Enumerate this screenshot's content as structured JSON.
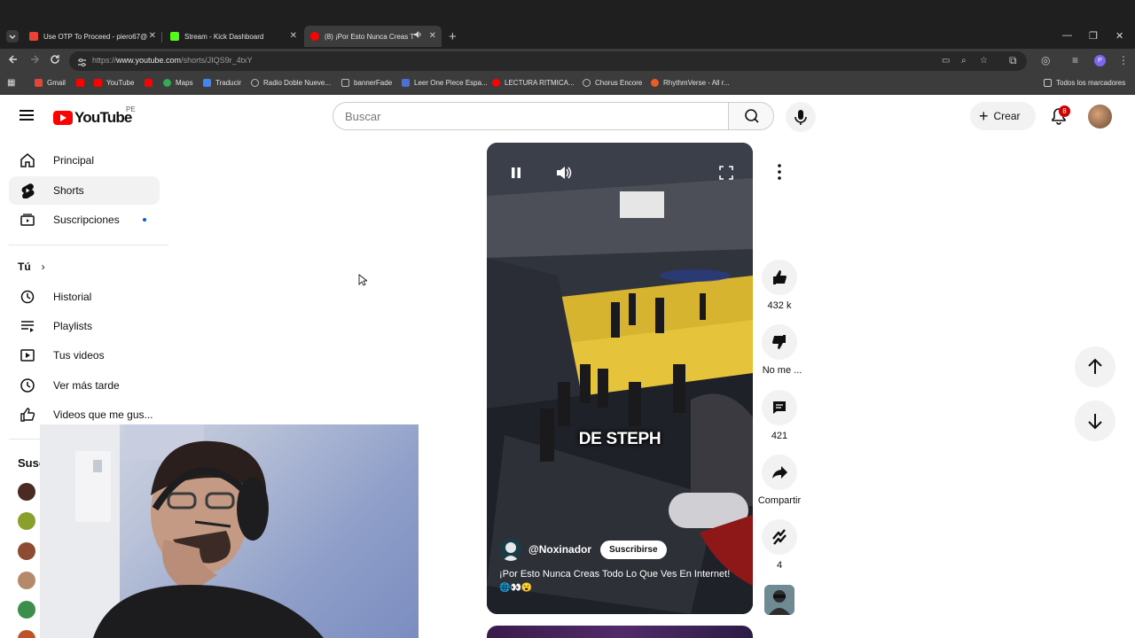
{
  "browser": {
    "tabs": [
      {
        "title": "Use OTP To Proceed - piero67@",
        "icon_color": "#ea4335"
      },
      {
        "title": "Stream - Kick Dashboard",
        "icon_color": "#53fc18"
      },
      {
        "title": "(8) ¡Por Esto Nunca Creas T",
        "icon_color": "#ff0000"
      }
    ],
    "url_prefix": "https://",
    "url_host": "www.youtube.com",
    "url_path": "/shorts/JIQS9r_4txY",
    "bookmarks": [
      {
        "label": "Gmail",
        "color": "#ea4335"
      },
      {
        "label": "",
        "color": "#ff0000"
      },
      {
        "label": "YouTube",
        "color": "#ff0000"
      },
      {
        "label": "",
        "color": "#ff0000"
      },
      {
        "label": "Maps",
        "color": "#34a853"
      },
      {
        "label": "Traducir",
        "color": "#4285f4"
      },
      {
        "label": "Radio Doble Nueve...",
        "color": "#9e9e9e"
      },
      {
        "label": "bannerFade",
        "color": "#9e9e9e"
      },
      {
        "label": "Leer One Piece Espa...",
        "color": "#4a6fd8"
      },
      {
        "label": "LECTURA RITMICA...",
        "color": "#ff0000"
      },
      {
        "label": "Chorus Encore",
        "color": "#9e9e9e"
      },
      {
        "label": "RhythmVerse - All r...",
        "color": "#e85d27"
      }
    ],
    "all_bookmarks": "Todos los marcadores"
  },
  "header": {
    "logo_text": "YouTube",
    "country_code": "PE",
    "search_placeholder": "Buscar",
    "create_label": "Crear",
    "notifications_count": "8"
  },
  "sidebar": {
    "main": [
      {
        "label": "Principal"
      },
      {
        "label": "Shorts"
      },
      {
        "label": "Suscripciones"
      }
    ],
    "you_heading": "Tú",
    "you_items": [
      {
        "label": "Historial"
      },
      {
        "label": "Playlists"
      },
      {
        "label": "Tus videos"
      },
      {
        "label": "Ver más tarde"
      },
      {
        "label": "Videos que me gus..."
      }
    ],
    "subs_heading": "Susc"
  },
  "short": {
    "overlay_caption": "DE STEPH",
    "channel": "@Noxinador",
    "subscribe_label": "Suscribirse",
    "title": "¡Por Esto Nunca Creas Todo Lo Que Ves En Internet!",
    "emojis": "🌐👀😮",
    "likes": "432 k",
    "dislike_label": "No me ...",
    "comments": "421",
    "share_label": "Compartir",
    "remix_count": "4"
  },
  "colors": {
    "brand_red": "#ff0000",
    "accent_blue": "#065fd4"
  }
}
